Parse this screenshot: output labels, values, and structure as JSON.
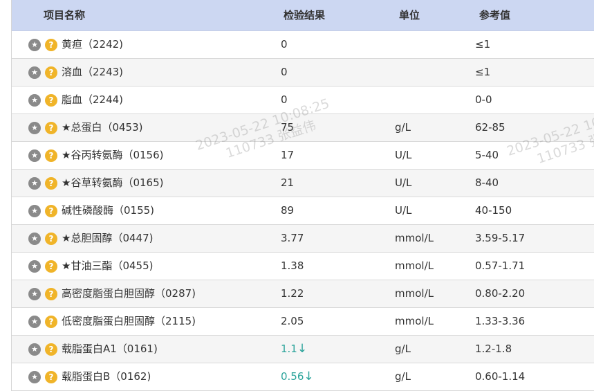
{
  "headers": {
    "name": "项目名称",
    "result": "检验结果",
    "unit": "单位",
    "reference": "参考值"
  },
  "rows": [
    {
      "name": "黄疸（2242)",
      "result": "0",
      "arrow": "",
      "unit": "",
      "reference": "≤1"
    },
    {
      "name": "溶血（2243)",
      "result": "0",
      "arrow": "",
      "unit": "",
      "reference": "≤1"
    },
    {
      "name": "脂血（2244)",
      "result": "0",
      "arrow": "",
      "unit": "",
      "reference": "0-0"
    },
    {
      "name": "★总蛋白（0453)",
      "result": "75",
      "arrow": "",
      "unit": "g/L",
      "reference": "62-85"
    },
    {
      "name": "★谷丙转氨酶（0156)",
      "result": "17",
      "arrow": "",
      "unit": "U/L",
      "reference": "5-40"
    },
    {
      "name": "★谷草转氨酶（0165)",
      "result": "21",
      "arrow": "",
      "unit": "U/L",
      "reference": "8-40"
    },
    {
      "name": "碱性磷酸酶（0155)",
      "result": "89",
      "arrow": "",
      "unit": "U/L",
      "reference": "40-150"
    },
    {
      "name": "★总胆固醇（0447)",
      "result": "3.77",
      "arrow": "",
      "unit": "mmol/L",
      "reference": "3.59-5.17"
    },
    {
      "name": "★甘油三酯（0455)",
      "result": "1.38",
      "arrow": "",
      "unit": "mmol/L",
      "reference": "0.57-1.71"
    },
    {
      "name": "高密度脂蛋白胆固醇（0287)",
      "result": "1.22",
      "arrow": "",
      "unit": "mmol/L",
      "reference": "0.80-2.20"
    },
    {
      "name": "低密度脂蛋白胆固醇（2115)",
      "result": "2.05",
      "arrow": "",
      "unit": "mmol/L",
      "reference": "1.33-3.36"
    },
    {
      "name": "载脂蛋白A1（0161)",
      "result": "1.1",
      "arrow": "↓",
      "unit": "g/L",
      "reference": "1.2-1.8"
    },
    {
      "name": "载脂蛋白B（0162)",
      "result": "0.56",
      "arrow": "↓",
      "unit": "g/L",
      "reference": "0.60-1.14"
    }
  ],
  "watermarks": [
    {
      "line1": "2023-05-22 10:08:25",
      "line2": "110733 张益伟"
    },
    {
      "line1": "2023-05-22 10",
      "line2": "110733 张"
    }
  ],
  "colors": {
    "header_bg": "#ccd7f2",
    "low_value": "#2aa39a",
    "help_icon": "#f0b429",
    "star_icon": "#8a8a8a"
  },
  "icons": {
    "row_star": "star-icon",
    "row_help": "help-icon"
  }
}
